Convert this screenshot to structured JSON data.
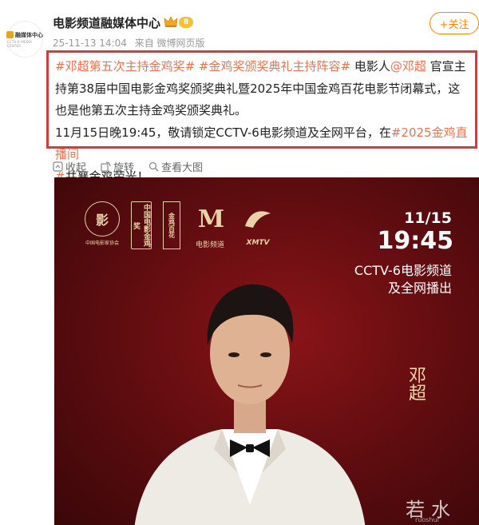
{
  "account": {
    "name": "电影频道融媒体中心",
    "level": "8",
    "avatar_text": "融媒体中心",
    "avatar_sub": "CCTV-6 MEDIA CENTER",
    "follow_label": "+关注"
  },
  "meta": {
    "date": "25-11-13 14:04",
    "source": "来自 微博网页版"
  },
  "post": {
    "tag1": "#邓超第五次主持金鸡奖#",
    "tag2": "#金鸡奖颁奖典礼主持阵容#",
    "text1": " 电影人",
    "mention": "@邓超",
    "text2": " 官宣主持第38届中国电影金鸡奖颁奖典礼暨2025年中国金鸡百花电影节闭幕式，这也是他第五次主持金鸡奖颁奖典礼。",
    "text3": "11月15日晚19:45，敬请锁定CCTV-6电影频道及全网平台，在",
    "tag3": "#2025金鸡直播间",
    "tag3b": "#",
    "text4": "共襄金鸡荣光！"
  },
  "actions": {
    "collapse": "收起",
    "rotate": "旋转",
    "view_large": "查看大图"
  },
  "poster": {
    "date": "11/15",
    "time": "19:45",
    "channel_line1": "CCTV-6电影频道",
    "channel_line2": "及全网播出",
    "host_name": "邓超",
    "logo1_caption": "中国电影家协会",
    "logo2_text": "中国电影金鸡奖",
    "logo3_text": "金鸡百花",
    "logo4_caption": "电影频道",
    "logo5_caption": "XMTV"
  },
  "watermark": {
    "text": "若水网",
    "sub": "ruoshui"
  },
  "colors": {
    "accent": "#ff8200",
    "link": "#eb7350",
    "highlight_border": "#d83a3a",
    "poster_bg": "#5c0c0f"
  }
}
